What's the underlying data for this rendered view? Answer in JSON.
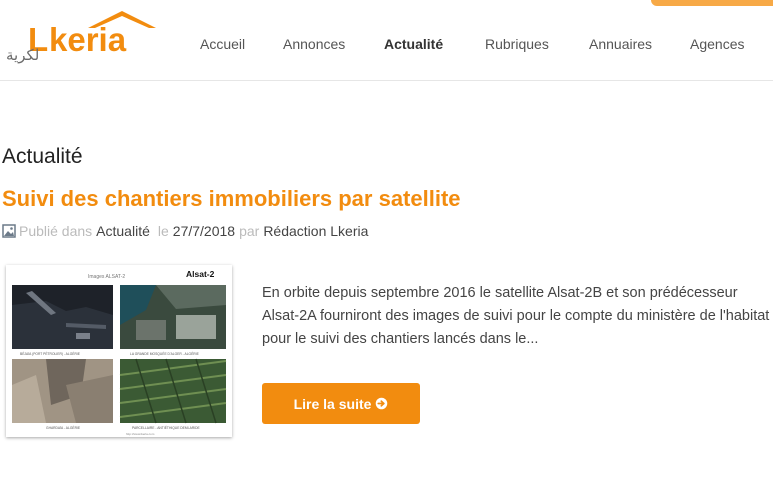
{
  "brand": {
    "logo_text_latin": "Lkeria",
    "logo_text_arabic": "لكرية",
    "accent_color": "#f28c0f",
    "logo_icon": "house-roof-icon"
  },
  "nav": {
    "items": [
      {
        "label": "Accueil",
        "active": false
      },
      {
        "label": "Annonces",
        "active": false
      },
      {
        "label": "Actualité",
        "active": true
      },
      {
        "label": "Rubriques",
        "active": false
      },
      {
        "label": "Annuaires",
        "active": false
      },
      {
        "label": "Agences",
        "active": false
      }
    ]
  },
  "page": {
    "section_title": "Actualité"
  },
  "article": {
    "title": "Suivi des chantiers immobiliers par satellite",
    "meta": {
      "published_in_label": "Publié dans",
      "category": "Actualité",
      "date_prefix": "le",
      "date": "27/7/2018",
      "author_prefix": "par",
      "author": "Rédaction Lkeria",
      "icon": "image-icon"
    },
    "thumbnail": {
      "header_text": "Images ALSAT-2",
      "badge": "Alsat-2",
      "captions": [
        "BÉJAÏA (PORT PÉTROLIER) - ALGÉRIE",
        "LA GRANDE MOSQUÉE D'ALGER - ALGÉRIE",
        "GHARDAÏA - ALGÉRIE",
        "PARCELLAIRE - ANTIÉTHIQUE DEMI-ARIDE"
      ],
      "footer": "http://www.lkeria.com"
    },
    "excerpt": "En orbite depuis septembre 2016 le satellite Alsat-2B et son prédécesseur Alsat-2A fourniront des images de suivi pour le compte du ministère de l'habitat pour le suivi des chantiers lancés dans le...",
    "read_more_label": "Lire la suite",
    "read_more_icon": "circle-arrow-right-icon"
  }
}
